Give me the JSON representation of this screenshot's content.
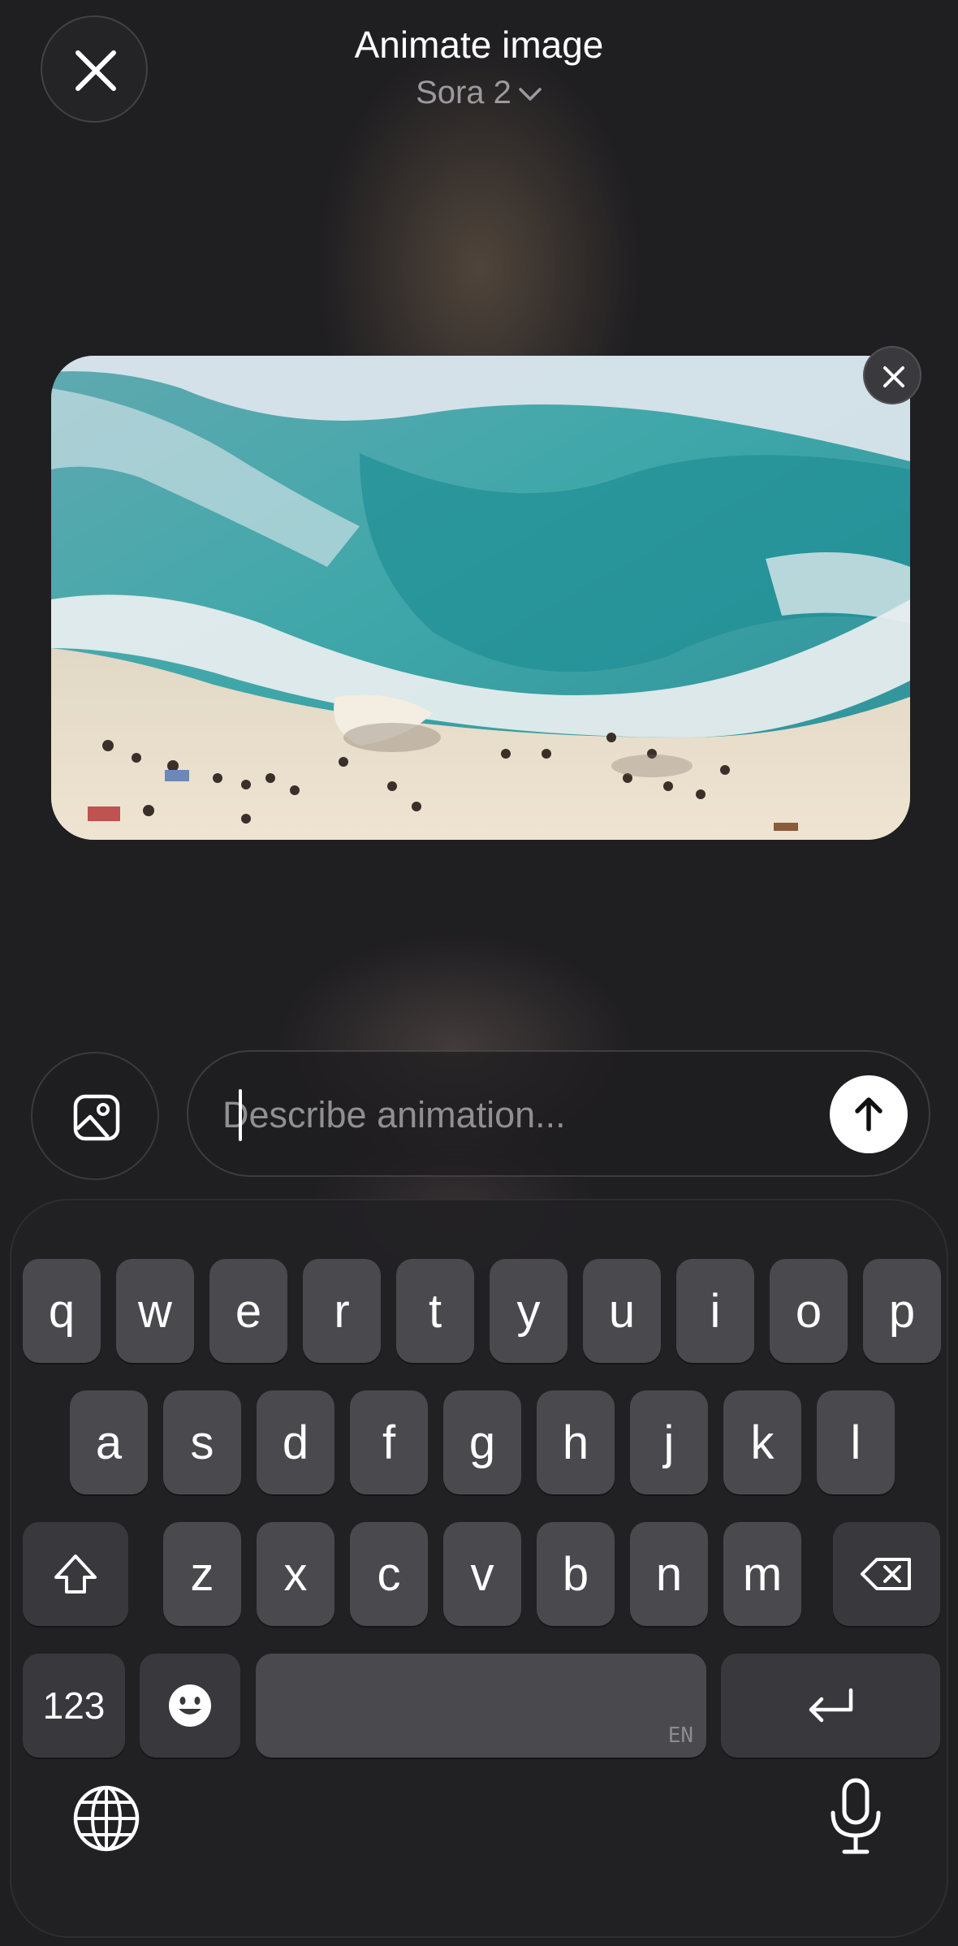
{
  "header": {
    "title": "Animate image",
    "model": "Sora 2"
  },
  "composer": {
    "placeholder": "Describe animation..."
  },
  "keyboard": {
    "row1": [
      "q",
      "w",
      "e",
      "r",
      "t",
      "y",
      "u",
      "i",
      "o",
      "p"
    ],
    "row2": [
      "a",
      "s",
      "d",
      "f",
      "g",
      "h",
      "j",
      "k",
      "l"
    ],
    "row3": [
      "z",
      "x",
      "c",
      "v",
      "b",
      "n",
      "m"
    ],
    "numbers_label": "123",
    "space_language": "EN"
  },
  "icons": {
    "close": "close-icon",
    "model_chevron": "chevron-down-icon",
    "remove_image": "close-icon",
    "gallery": "image-gallery-icon",
    "send": "arrow-up-icon",
    "shift": "shift-icon",
    "delete": "backspace-icon",
    "emoji": "emoji-icon",
    "return": "return-icon",
    "globe": "globe-icon",
    "mic": "microphone-icon"
  },
  "colors": {
    "background": "#1f1e21",
    "key": "#4a494e",
    "send_button": "#ffffff"
  }
}
